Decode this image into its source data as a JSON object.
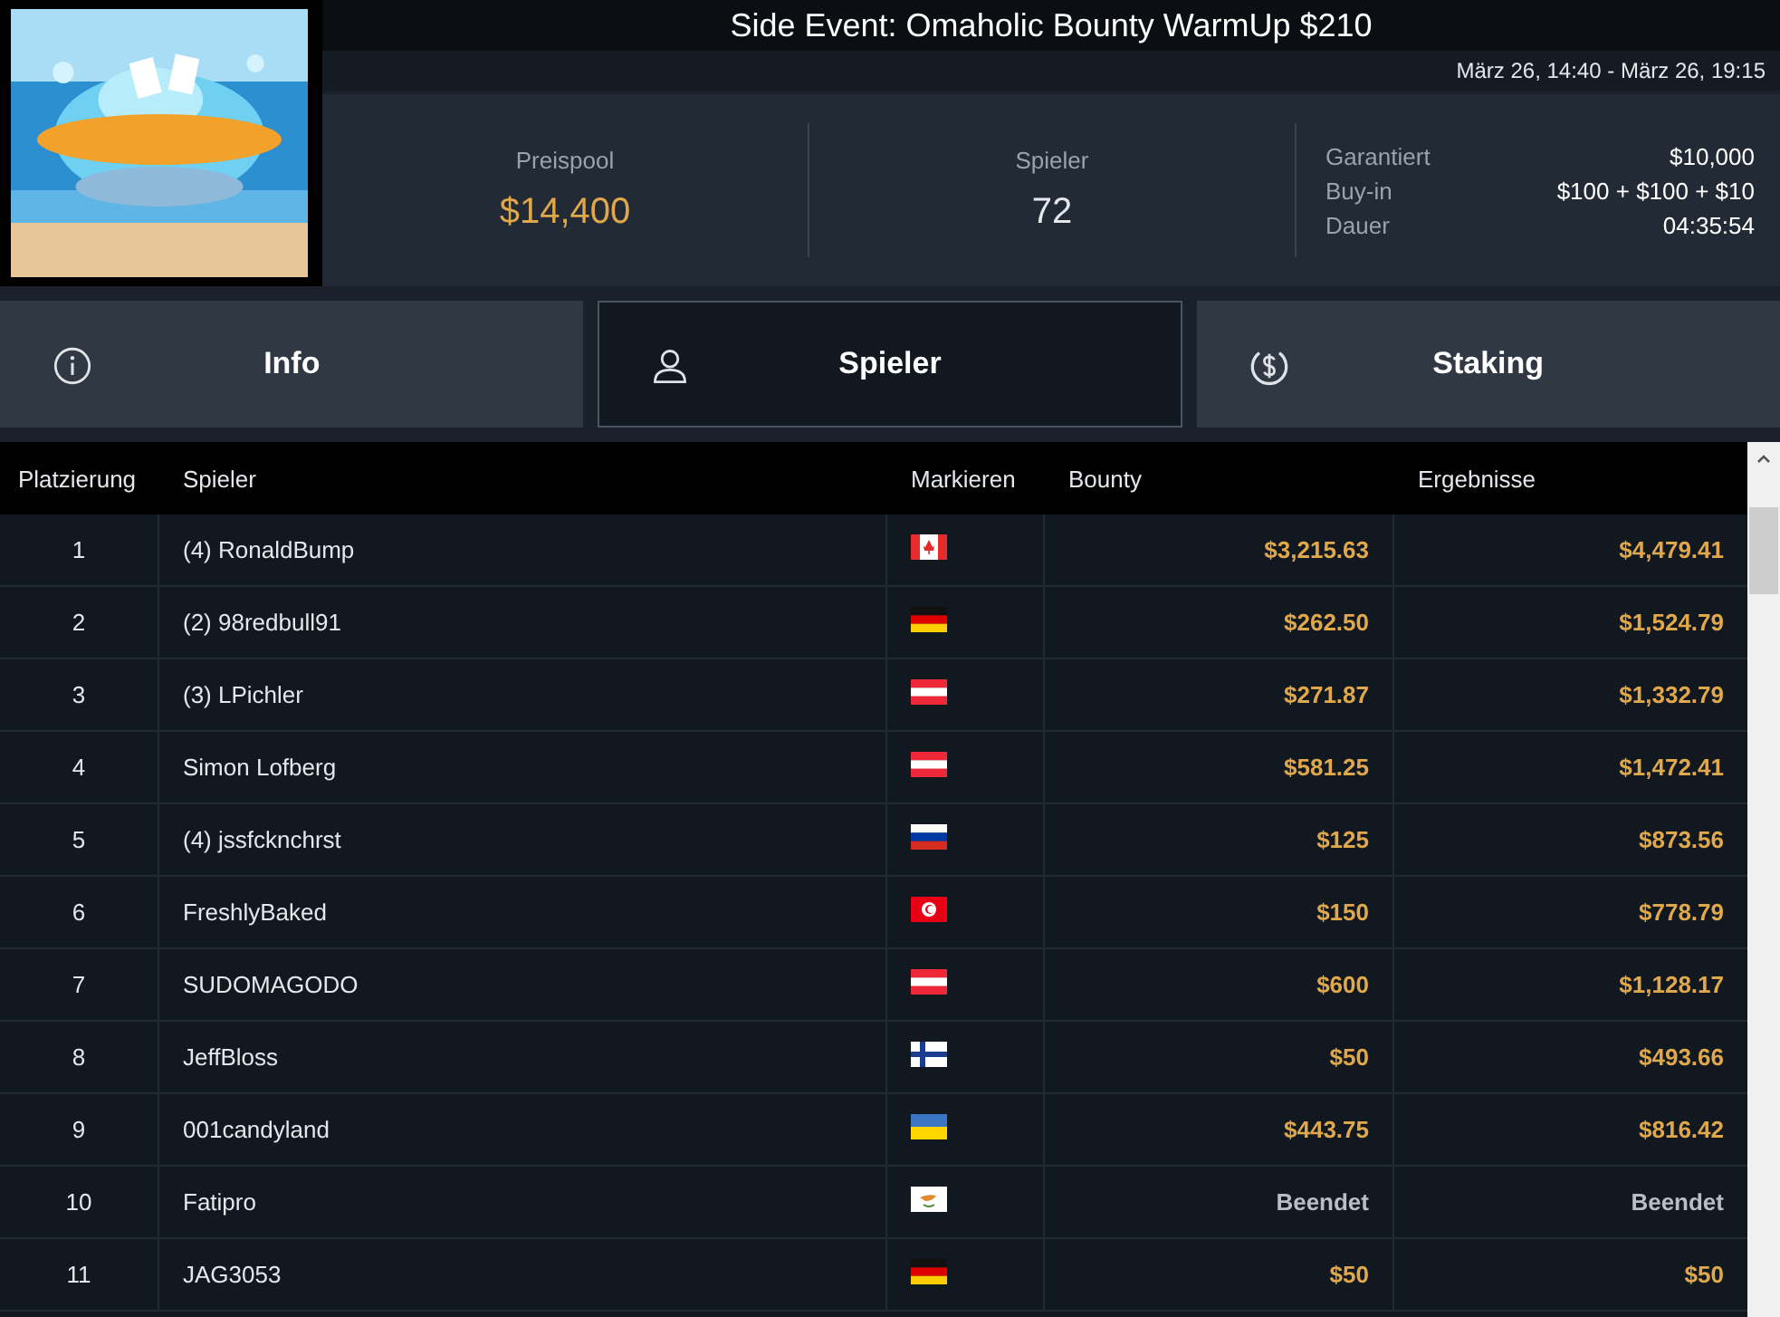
{
  "header": {
    "title": "Side Event: Omaholic Bounty WarmUp $210",
    "dates": "März 26, 14:40 - März 26, 19:15"
  },
  "stats": [
    {
      "label": "Preispool",
      "value": "$14,400",
      "kind": "money"
    },
    {
      "label": "Spieler",
      "value": "72",
      "kind": "plain"
    }
  ],
  "details": [
    {
      "label": "Garantiert",
      "value": "$10,000"
    },
    {
      "label": "Buy-in",
      "value": "$100 + $100 + $10"
    },
    {
      "label": "Dauer",
      "value": "04:35:54"
    }
  ],
  "tabs": [
    {
      "label": "Info",
      "selected": false
    },
    {
      "label": "Spieler",
      "selected": true
    },
    {
      "label": "Staking",
      "selected": false
    }
  ],
  "table": {
    "columns": [
      "Platzierung",
      "Spieler",
      "Markieren",
      "Bounty",
      "Ergebnisse"
    ],
    "rows": [
      {
        "place": "1",
        "player": "(4) RonaldBump",
        "kind": "ca",
        "bounty": "$3,215.63",
        "result": "$4,479.41",
        "finished": false
      },
      {
        "place": "2",
        "player": "(2) 98redbull91",
        "kind": "de",
        "bounty": "$262.50",
        "result": "$1,524.79",
        "finished": false
      },
      {
        "place": "3",
        "player": "(3) LPichler",
        "kind": "at",
        "bounty": "$271.87",
        "result": "$1,332.79",
        "finished": false
      },
      {
        "place": "4",
        "player": "Simon Lofberg",
        "kind": "at",
        "bounty": "$581.25",
        "result": "$1,472.41",
        "finished": false
      },
      {
        "place": "5",
        "player": "(4) jssfcknchrst",
        "kind": "ru",
        "bounty": "$125",
        "result": "$873.56",
        "finished": false
      },
      {
        "place": "6",
        "player": "FreshlyBaked",
        "kind": "tn",
        "bounty": "$150",
        "result": "$778.79",
        "finished": false
      },
      {
        "place": "7",
        "player": "SUDOMAGODO",
        "kind": "at",
        "bounty": "$600",
        "result": "$1,128.17",
        "finished": false
      },
      {
        "place": "8",
        "player": "JeffBloss",
        "kind": "fi",
        "bounty": "$50",
        "result": "$493.66",
        "finished": false
      },
      {
        "place": "9",
        "player": "001candyland",
        "kind": "ua",
        "bounty": "$443.75",
        "result": "$816.42",
        "finished": false
      },
      {
        "place": "10",
        "player": "Fatipro",
        "kind": "cy",
        "bounty": "Beendet",
        "result": "Beendet",
        "finished": true
      },
      {
        "place": "11",
        "player": "JAG3053",
        "kind": "de",
        "bounty": "$50",
        "result": "$50",
        "finished": false
      }
    ]
  }
}
